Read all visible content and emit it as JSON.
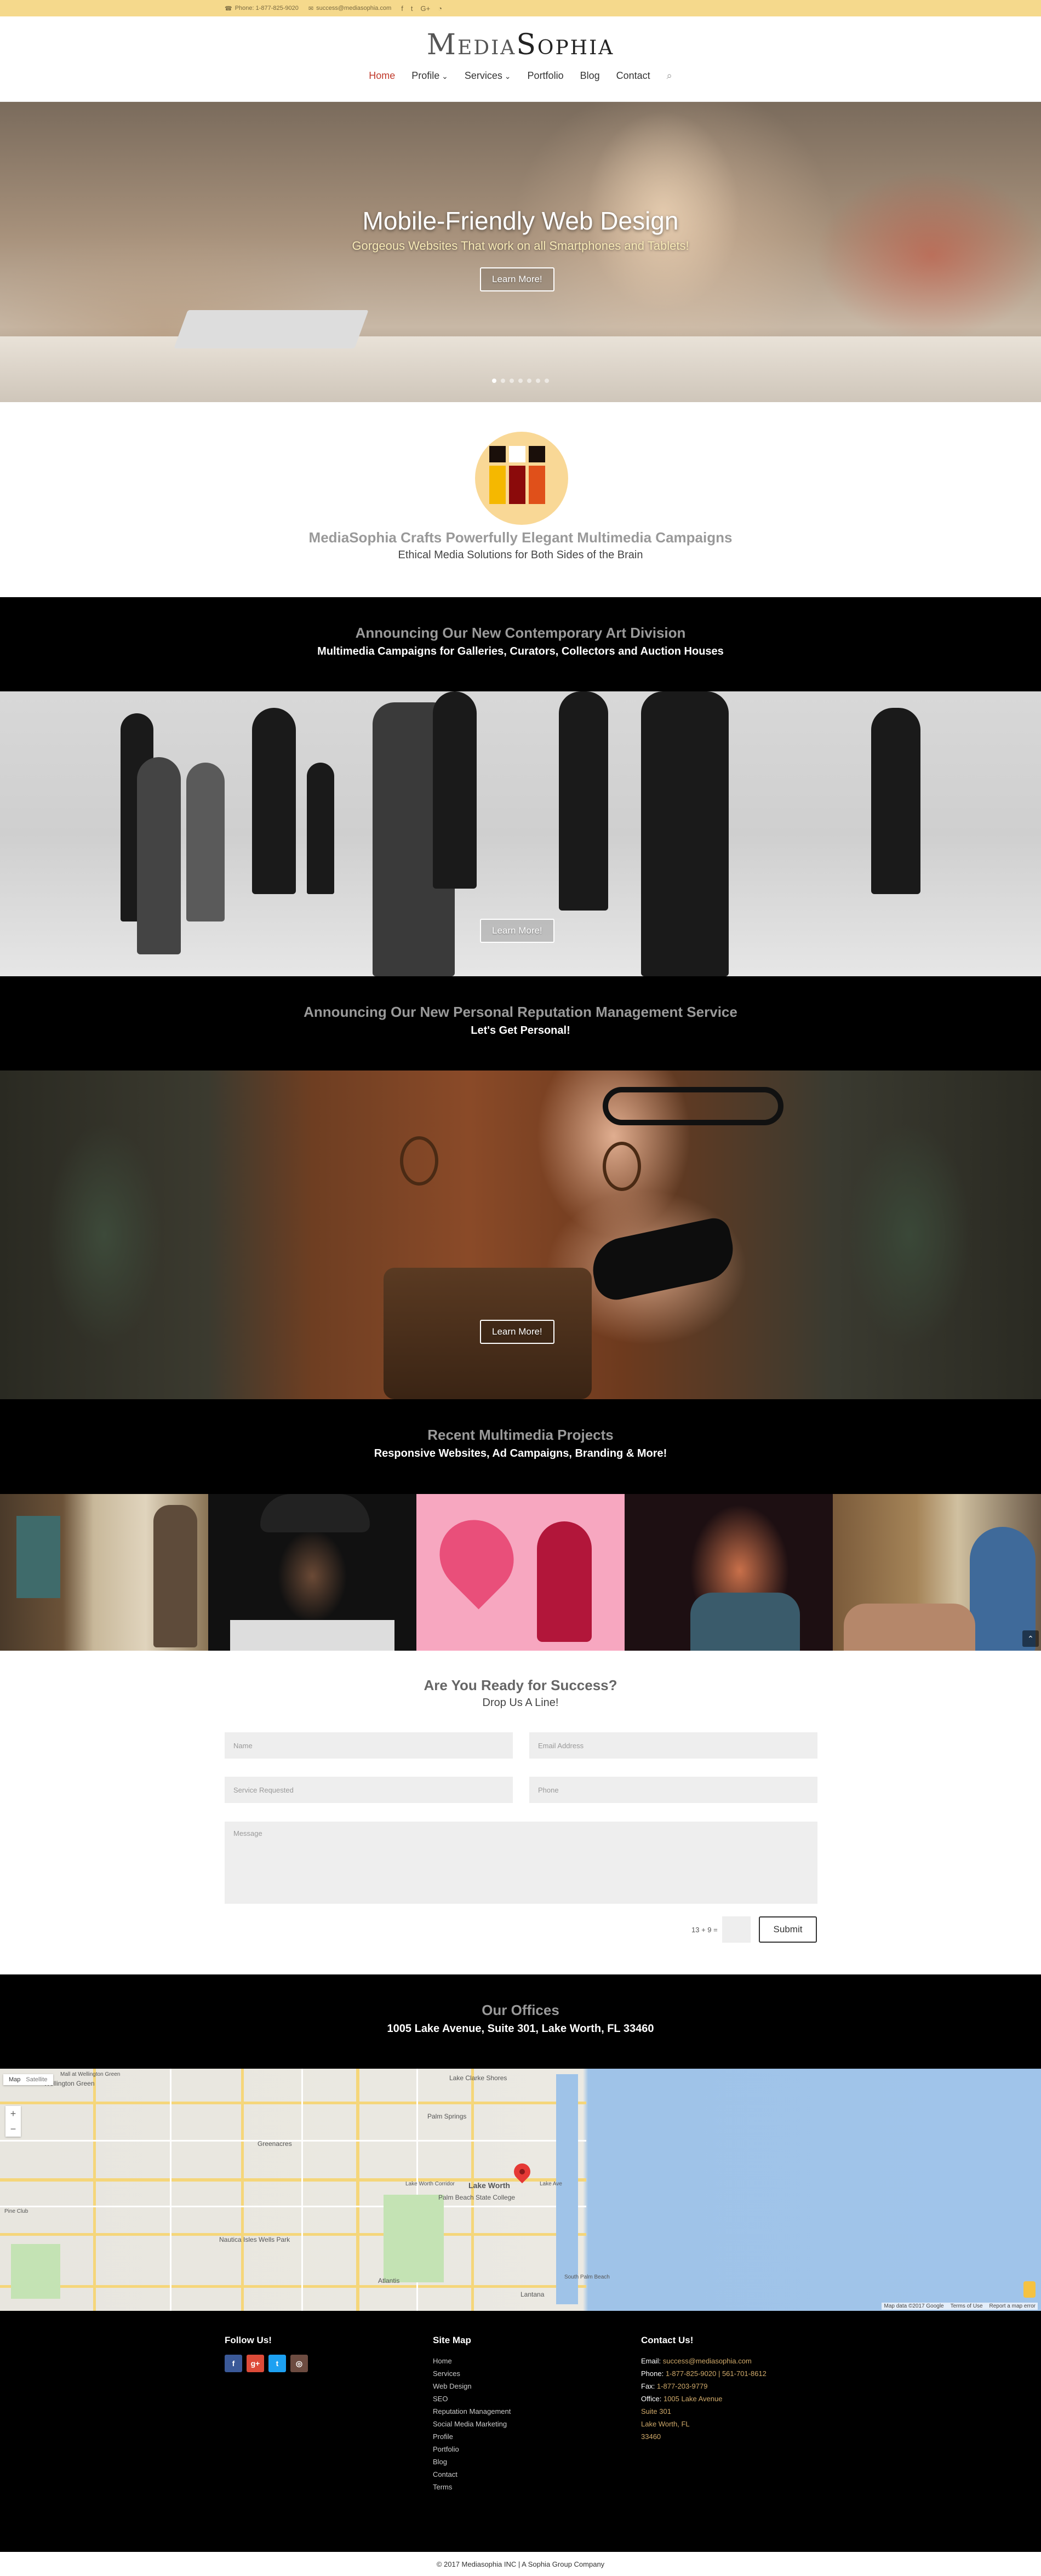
{
  "topbar": {
    "phone": "Phone: 1-877-825-9020",
    "email": "success@mediasophia.com",
    "social": [
      "f",
      "t",
      "G+",
      "rss"
    ]
  },
  "header": {
    "logo_part1": "Media",
    "logo_part2": "Sophia",
    "nav": [
      "Home",
      "Profile",
      "Services",
      "Portfolio",
      "Blog",
      "Contact"
    ]
  },
  "hero": {
    "title": "Mobile-Friendly Web Design",
    "subtitle": "Gorgeous Websites That work on all Smartphones and Tablets!",
    "button": "Learn More!",
    "slide_count": 7,
    "active_slide": 1
  },
  "intro": {
    "headline": "MediaSophia Crafts Powerfully Elegant Multimedia Campaigns",
    "subheadline": "Ethical Media Solutions for Both Sides of the Brain"
  },
  "art_division": {
    "headline": "Announcing Our New Contemporary Art Division",
    "subheadline": "Multimedia Campaigns for Galleries, Curators, Collectors and Auction Houses",
    "button": "Learn More!"
  },
  "reputation": {
    "headline": "Announcing Our New Personal Reputation Management Service",
    "subheadline": "Let's Get Personal!",
    "button": "Learn More!"
  },
  "projects": {
    "headline": "Recent Multimedia Projects",
    "subheadline": "Responsive Websites, Ad Campaigns, Branding & More!"
  },
  "contact": {
    "headline": "Are You Ready for Success?",
    "subheadline": "Drop Us A Line!",
    "name_placeholder": "Name",
    "email_placeholder": "Email Address",
    "service_placeholder": "Service Requested",
    "phone_placeholder": "Phone",
    "message_placeholder": "Message",
    "captcha": "13 + 9 =",
    "submit": "Submit"
  },
  "offices": {
    "headline": "Our Offices",
    "address": "1005 Lake Avenue, Suite 301, Lake Worth, FL 33460"
  },
  "map": {
    "tab_map": "Map",
    "tab_satellite": "Satellite",
    "labels": [
      "Greenacres",
      "Palm Springs",
      "Lake Worth",
      "Lake Clarke Shores",
      "Palm Beach State College",
      "Nautica Isles Wells Park",
      "Lantana",
      "Atlantis",
      "Wellington Green",
      "South Palm Beach",
      "Lake Ave",
      "Mall at Wellington Green",
      "Lake Worth Corridor",
      "Pine Club"
    ],
    "footer": [
      "Map data ©2017 Google",
      "Terms of Use",
      "Report a map error"
    ]
  },
  "footer": {
    "follow_title": "Follow Us!",
    "sitemap_title": "Site Map",
    "sitemap": [
      "Home",
      "Services",
      "Web Design",
      "SEO",
      "Reputation Management",
      "Social Media Marketing",
      "Profile",
      "Portfolio",
      "Blog",
      "Contact",
      "Terms"
    ],
    "contact_title": "Contact Us!",
    "contact_email_label": "Email:",
    "contact_email": "success@mediasophia.com",
    "contact_phone_label": "Phone:",
    "contact_phone": "1-877-825-9020 | 561-701-8612",
    "contact_fax_label": "Fax:",
    "contact_fax": "1-877-203-9779",
    "contact_office_label": "Office:",
    "contact_office_lines": [
      "1005 Lake Avenue",
      "Suite 301",
      "Lake Worth, FL",
      "33460"
    ],
    "social_colors": [
      "#3b5998",
      "#dd4b39",
      "#1da1f2",
      "#6d4c41"
    ]
  },
  "bottom": {
    "copyright": "© 2017 Mediasophia INC | A Sophia Group Company"
  },
  "colors": {
    "topbar": "#f5d98c",
    "accent": "#c0392b",
    "band": "#000000"
  }
}
